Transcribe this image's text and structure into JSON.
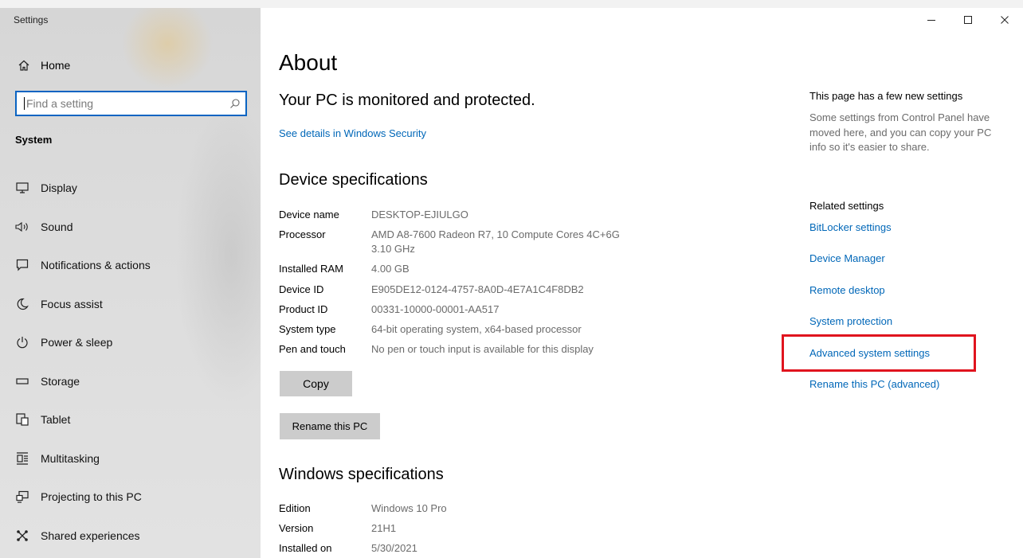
{
  "window": {
    "app_title": "Settings",
    "controls": {
      "minimize": "–",
      "maximize": "□",
      "close": "✕"
    }
  },
  "sidebar": {
    "home_label": "Home",
    "search_placeholder": "Find a setting",
    "section_label": "System",
    "items": [
      {
        "label": "Display",
        "icon": "display-icon"
      },
      {
        "label": "Sound",
        "icon": "sound-icon"
      },
      {
        "label": "Notifications & actions",
        "icon": "notifications-icon"
      },
      {
        "label": "Focus assist",
        "icon": "moon-icon"
      },
      {
        "label": "Power & sleep",
        "icon": "power-icon"
      },
      {
        "label": "Storage",
        "icon": "storage-icon"
      },
      {
        "label": "Tablet",
        "icon": "tablet-icon"
      },
      {
        "label": "Multitasking",
        "icon": "multitasking-icon"
      },
      {
        "label": "Projecting to this PC",
        "icon": "projecting-icon"
      },
      {
        "label": "Shared experiences",
        "icon": "shared-experiences-icon"
      }
    ]
  },
  "main": {
    "page_title": "About",
    "protection_heading": "Your PC is monitored and protected.",
    "security_link": "See details in Windows Security",
    "device_heading": "Device specifications",
    "device_specs": [
      {
        "key": "Device name",
        "value": "DESKTOP-EJIULGO"
      },
      {
        "key": "Processor",
        "value": "AMD A8-7600 Radeon R7, 10 Compute Cores 4C+6G 3.10 GHz"
      },
      {
        "key": "Installed RAM",
        "value": "4.00 GB"
      },
      {
        "key": "Device ID",
        "value": "E905DE12-0124-4757-8A0D-4E7A1C4F8DB2"
      },
      {
        "key": "Product ID",
        "value": "00331-10000-00001-AA517"
      },
      {
        "key": "System type",
        "value": "64-bit operating system, x64-based processor"
      },
      {
        "key": "Pen and touch",
        "value": "No pen or touch input is available for this display"
      }
    ],
    "copy_button": "Copy",
    "rename_button": "Rename this PC",
    "windows_heading": "Windows specifications",
    "windows_specs": [
      {
        "key": "Edition",
        "value": "Windows 10 Pro"
      },
      {
        "key": "Version",
        "value": "21H1"
      },
      {
        "key": "Installed on",
        "value": "5/30/2021"
      }
    ]
  },
  "right_panel": {
    "notice_title": "This page has a few new settings",
    "notice_body": "Some settings from Control Panel have moved here, and you can copy your PC info so it's easier to share.",
    "related_title": "Related settings",
    "links": [
      "BitLocker settings",
      "Device Manager",
      "Remote desktop",
      "System protection",
      "Advanced system settings",
      "Rename this PC (advanced)"
    ]
  },
  "colors": {
    "accent": "#0067b8",
    "highlight_border": "#e0141e",
    "search_border": "#0a64c2"
  }
}
